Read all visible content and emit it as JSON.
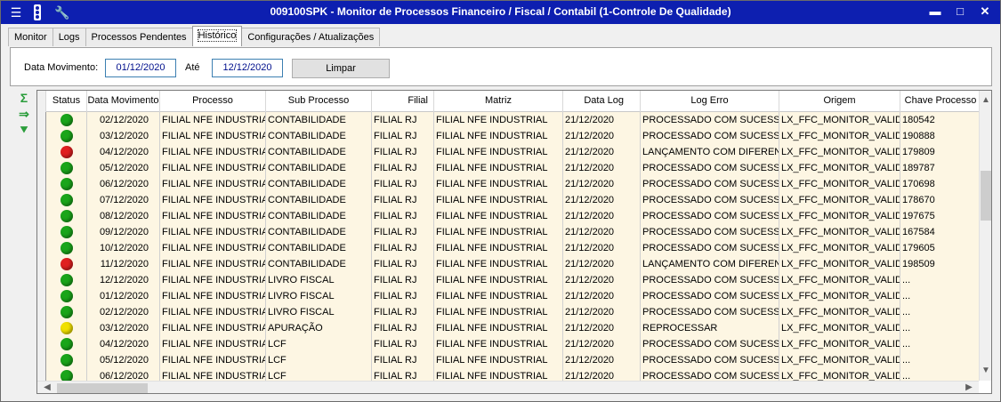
{
  "window": {
    "title": "009100SPK - Monitor de Processos Financeiro / Fiscal / Contabil (1-Controle De Qualidade)",
    "icons": [
      "menu-icon",
      "traffic-light-icon",
      "wrench-icon"
    ],
    "controls": {
      "minimize": "▬",
      "maximize": "□",
      "close": "✕"
    }
  },
  "tabs": [
    {
      "label": "Monitor"
    },
    {
      "label": "Logs"
    },
    {
      "label": "Processos Pendentes"
    },
    {
      "label": "Histórico",
      "active": true
    },
    {
      "label": "Configurações / Atualizações"
    }
  ],
  "filter": {
    "date_label": "Data Movimento:",
    "date_from": "01/12/2020",
    "until_label": "Até",
    "date_to": "12/12/2020",
    "clear_button": "Limpar"
  },
  "side_tools": [
    {
      "icon": "sum-icon",
      "glyph": "Σ"
    },
    {
      "icon": "export-icon",
      "glyph": "⇒"
    },
    {
      "icon": "filter-down-icon",
      "glyph": "⯆"
    }
  ],
  "colors": {
    "title_bar": "#0d1fb0",
    "row_bg": "#fdf6e3",
    "status_green": "#1aa51a",
    "status_red": "#e02020",
    "status_yellow": "#f0e000"
  },
  "grid": {
    "columns": [
      "Status",
      "Data Movimento",
      "Processo",
      "Sub Processo",
      "Filial",
      "Matriz",
      "Data Log",
      "Log Erro",
      "Origem",
      "Chave Processo"
    ],
    "rows": [
      {
        "status": "green",
        "data_mov": "02/12/2020",
        "processo": "FILIAL NFE INDUSTRIAL",
        "sub": "CONTABILIDADE",
        "filial": "FILIAL RJ",
        "matriz": "FILIAL NFE INDUSTRIAL",
        "data_log": "21/12/2020",
        "log_erro": "PROCESSADO COM SUCESSO",
        "origem": "LX_FFC_MONITOR_VALIDA",
        "chave": "180542"
      },
      {
        "status": "green",
        "data_mov": "03/12/2020",
        "processo": "FILIAL NFE INDUSTRIAL",
        "sub": "CONTABILIDADE",
        "filial": "FILIAL RJ",
        "matriz": "FILIAL NFE INDUSTRIAL",
        "data_log": "21/12/2020",
        "log_erro": "PROCESSADO COM SUCESSO",
        "origem": "LX_FFC_MONITOR_VALIDA",
        "chave": "190888"
      },
      {
        "status": "red",
        "data_mov": "04/12/2020",
        "processo": "FILIAL NFE INDUSTRIAL",
        "sub": "CONTABILIDADE",
        "filial": "FILIAL RJ",
        "matriz": "FILIAL NFE INDUSTRIAL",
        "data_log": "21/12/2020",
        "log_erro": "LANÇAMENTO COM DIFERENÇA",
        "origem": "LX_FFC_MONITOR_VALIDA",
        "chave": "179809"
      },
      {
        "status": "green",
        "data_mov": "05/12/2020",
        "processo": "FILIAL NFE INDUSTRIAL",
        "sub": "CONTABILIDADE",
        "filial": "FILIAL RJ",
        "matriz": "FILIAL NFE INDUSTRIAL",
        "data_log": "21/12/2020",
        "log_erro": "PROCESSADO COM SUCESSO",
        "origem": "LX_FFC_MONITOR_VALIDA",
        "chave": "189787"
      },
      {
        "status": "green",
        "data_mov": "06/12/2020",
        "processo": "FILIAL NFE INDUSTRIAL",
        "sub": "CONTABILIDADE",
        "filial": "FILIAL RJ",
        "matriz": "FILIAL NFE INDUSTRIAL",
        "data_log": "21/12/2020",
        "log_erro": "PROCESSADO COM SUCESSO",
        "origem": "LX_FFC_MONITOR_VALIDA",
        "chave": "170698"
      },
      {
        "status": "green",
        "data_mov": "07/12/2020",
        "processo": "FILIAL NFE INDUSTRIAL",
        "sub": "CONTABILIDADE",
        "filial": "FILIAL RJ",
        "matriz": "FILIAL NFE INDUSTRIAL",
        "data_log": "21/12/2020",
        "log_erro": "PROCESSADO COM SUCESSO",
        "origem": "LX_FFC_MONITOR_VALIDA",
        "chave": "178670"
      },
      {
        "status": "green",
        "data_mov": "08/12/2020",
        "processo": "FILIAL NFE INDUSTRIAL",
        "sub": "CONTABILIDADE",
        "filial": "FILIAL RJ",
        "matriz": "FILIAL NFE INDUSTRIAL",
        "data_log": "21/12/2020",
        "log_erro": "PROCESSADO COM SUCESSO",
        "origem": "LX_FFC_MONITOR_VALIDA",
        "chave": "197675"
      },
      {
        "status": "green",
        "data_mov": "09/12/2020",
        "processo": "FILIAL NFE INDUSTRIAL",
        "sub": "CONTABILIDADE",
        "filial": "FILIAL RJ",
        "matriz": "FILIAL NFE INDUSTRIAL",
        "data_log": "21/12/2020",
        "log_erro": "PROCESSADO COM SUCESSO",
        "origem": "LX_FFC_MONITOR_VALIDA",
        "chave": "167584"
      },
      {
        "status": "green",
        "data_mov": "10/12/2020",
        "processo": "FILIAL NFE INDUSTRIAL",
        "sub": "CONTABILIDADE",
        "filial": "FILIAL RJ",
        "matriz": "FILIAL NFE INDUSTRIAL",
        "data_log": "21/12/2020",
        "log_erro": "PROCESSADO COM SUCESSO",
        "origem": "LX_FFC_MONITOR_VALIDA",
        "chave": "179605"
      },
      {
        "status": "red",
        "data_mov": "11/12/2020",
        "processo": "FILIAL NFE INDUSTRIAL",
        "sub": "CONTABILIDADE",
        "filial": "FILIAL RJ",
        "matriz": "FILIAL NFE INDUSTRIAL",
        "data_log": "21/12/2020",
        "log_erro": "LANÇAMENTO COM DIFERENÇA",
        "origem": "LX_FFC_MONITOR_VALIDA",
        "chave": "198509"
      },
      {
        "status": "green",
        "data_mov": "12/12/2020",
        "processo": "FILIAL NFE INDUSTRIAL",
        "sub": "LIVRO FISCAL",
        "filial": "FILIAL RJ",
        "matriz": "FILIAL NFE INDUSTRIAL",
        "data_log": "21/12/2020",
        "log_erro": "PROCESSADO COM SUCESSO",
        "origem": "LX_FFC_MONITOR_VALIDA",
        "chave": "..."
      },
      {
        "status": "green",
        "data_mov": "01/12/2020",
        "processo": "FILIAL NFE INDUSTRIAL",
        "sub": "LIVRO FISCAL",
        "filial": "FILIAL RJ",
        "matriz": "FILIAL NFE INDUSTRIAL",
        "data_log": "21/12/2020",
        "log_erro": "PROCESSADO COM SUCESSO",
        "origem": "LX_FFC_MONITOR_VALIDA",
        "chave": "..."
      },
      {
        "status": "green",
        "data_mov": "02/12/2020",
        "processo": "FILIAL NFE INDUSTRIAL",
        "sub": "LIVRO FISCAL",
        "filial": "FILIAL RJ",
        "matriz": "FILIAL NFE INDUSTRIAL",
        "data_log": "21/12/2020",
        "log_erro": "PROCESSADO COM SUCESSO",
        "origem": "LX_FFC_MONITOR_VALIDA",
        "chave": "..."
      },
      {
        "status": "yellow",
        "data_mov": "03/12/2020",
        "processo": "FILIAL NFE INDUSTRIAL",
        "sub": "APURAÇÃO",
        "filial": "FILIAL RJ",
        "matriz": "FILIAL NFE INDUSTRIAL",
        "data_log": "21/12/2020",
        "log_erro": "REPROCESSAR",
        "origem": "LX_FFC_MONITOR_VALIDA",
        "chave": "..."
      },
      {
        "status": "green",
        "data_mov": "04/12/2020",
        "processo": "FILIAL NFE INDUSTRIAL",
        "sub": "LCF",
        "filial": "FILIAL RJ",
        "matriz": "FILIAL NFE INDUSTRIAL",
        "data_log": "21/12/2020",
        "log_erro": "PROCESSADO COM SUCESSO",
        "origem": "LX_FFC_MONITOR_VALIDA",
        "chave": "..."
      },
      {
        "status": "green",
        "data_mov": "05/12/2020",
        "processo": "FILIAL NFE INDUSTRIAL",
        "sub": "LCF",
        "filial": "FILIAL RJ",
        "matriz": "FILIAL NFE INDUSTRIAL",
        "data_log": "21/12/2020",
        "log_erro": "PROCESSADO COM SUCESSO",
        "origem": "LX_FFC_MONITOR_VALIDA",
        "chave": "..."
      },
      {
        "status": "green",
        "data_mov": "06/12/2020",
        "processo": "FILIAL NFE INDUSTRIAL",
        "sub": "LCF",
        "filial": "FILIAL RJ",
        "matriz": "FILIAL NFE INDUSTRIAL",
        "data_log": "21/12/2020",
        "log_erro": "PROCESSADO COM SUCESSO",
        "origem": "LX_FFC_MONITOR_VALIDA",
        "chave": "..."
      }
    ]
  }
}
